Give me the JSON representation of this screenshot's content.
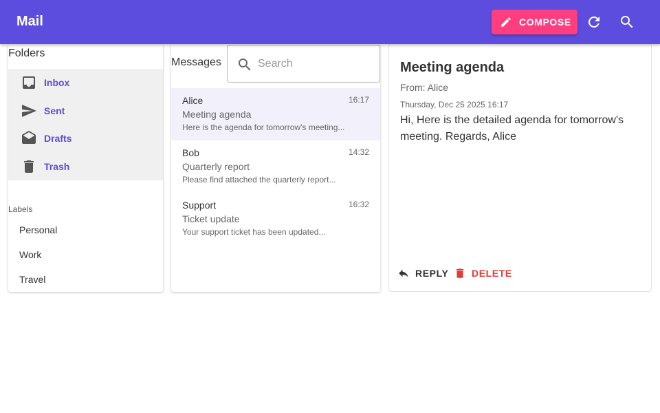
{
  "appbar": {
    "title": "Mail",
    "compose_label": "COMPOSE",
    "icons": [
      "edit-icon",
      "refresh-icon",
      "search-icon"
    ]
  },
  "folders": {
    "heading": "Folders",
    "items": [
      {
        "label": "Inbox",
        "icon": "inbox-icon"
      },
      {
        "label": "Sent",
        "icon": "send-icon"
      },
      {
        "label": "Drafts",
        "icon": "drafts-icon"
      },
      {
        "label": "Trash",
        "icon": "trash-icon"
      }
    ],
    "labels_heading": "Labels",
    "labels": [
      "Personal",
      "Work",
      "Travel"
    ]
  },
  "messages": {
    "heading": "Messages",
    "search": {
      "placeholder": "Search",
      "value": ""
    },
    "items": [
      {
        "sender": "Alice",
        "time": "16:17",
        "subject": "Meeting agenda",
        "preview": "Here is the agenda for tomorrow's meeting...",
        "selected": true
      },
      {
        "sender": "Bob",
        "time": "14:32",
        "subject": "Quarterly report",
        "preview": "Please find attached the quarterly report...",
        "selected": false
      },
      {
        "sender": "Support",
        "time": "16:32",
        "subject": "Ticket update",
        "preview": "Your support ticket has been updated...",
        "selected": false
      }
    ]
  },
  "reader": {
    "subject": "Meeting agenda",
    "from": "From: Alice",
    "date": "Thursday, Dec 25 2025 16:17",
    "body": "Hi, Here is the detailed agenda for tomorrow's meeting. Regards, Alice",
    "reply_label": "REPLY",
    "delete_label": "DELETE"
  },
  "colors": {
    "primary": "#5c4ddf",
    "accent": "#ff3d7f",
    "danger": "#e53935",
    "selected_row": "#f2f1fb",
    "folder_bg": "#f0f0f0"
  }
}
